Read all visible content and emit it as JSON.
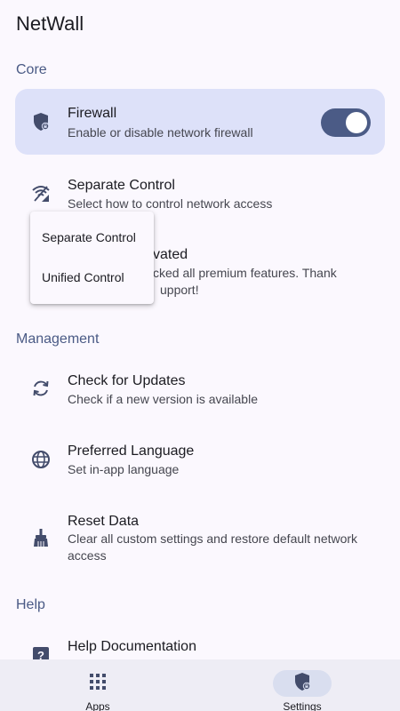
{
  "app": {
    "title": "NetWall"
  },
  "colors": {
    "accent": "#4b5b86",
    "active_row_bg": "#dde1f9",
    "section_header": "#4a5a85",
    "icon": "#434c6b"
  },
  "sections": {
    "core": "Core",
    "management": "Management",
    "help": "Help"
  },
  "settings": {
    "firewall": {
      "title": "Firewall",
      "subtitle": "Enable or disable network firewall",
      "icon": "shield-icon",
      "enabled": true
    },
    "separate_control": {
      "title": "Separate Control",
      "subtitle": "Select how to control network access",
      "icon": "signal-icon"
    },
    "premium": {
      "title_partial": "tivated",
      "subtitle_line1": "cked all premium features. Thank",
      "subtitle_line2": "upport!",
      "icon": "premium-icon"
    },
    "check_updates": {
      "title": "Check for Updates",
      "subtitle": "Check if a new version is available",
      "icon": "sync-icon"
    },
    "language": {
      "title": "Preferred Language",
      "subtitle": "Set in-app language",
      "icon": "globe-icon"
    },
    "reset": {
      "title": "Reset Data",
      "subtitle": "Clear all custom settings and restore default network access",
      "icon": "broom-icon"
    },
    "help_docs": {
      "title": "Help Documentation",
      "icon": "help-icon"
    }
  },
  "dropdown": {
    "options": [
      "Separate Control",
      "Unified Control"
    ]
  },
  "bottom_nav": {
    "apps": {
      "label": "Apps",
      "icon": "grid-icon"
    },
    "settings": {
      "label": "Settings",
      "icon": "shield-icon",
      "selected": true
    }
  }
}
